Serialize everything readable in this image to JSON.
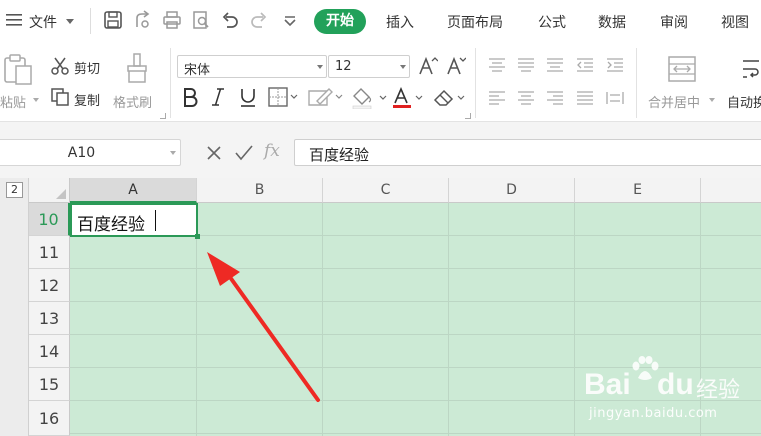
{
  "menubar": {
    "file_label": "文件",
    "tabs": [
      "开始",
      "插入",
      "页面布局",
      "公式",
      "数据",
      "审阅",
      "视图"
    ],
    "active_tab": "开始"
  },
  "ribbon": {
    "paste_label": "粘贴",
    "cut_label": "剪切",
    "copy_label": "复制",
    "format_painter_label": "格式刷",
    "font_name": "宋体",
    "font_size": "12",
    "merge_center_label": "合并居中",
    "auto_wrap_label": "自动换"
  },
  "formula_bar": {
    "name_box": "A10",
    "fx_label": "fx",
    "formula_value": "百度经验"
  },
  "sheet": {
    "outline_level": "2",
    "columns": [
      "A",
      "B",
      "C",
      "D",
      "E"
    ],
    "rows": [
      "10",
      "11",
      "12",
      "13",
      "14",
      "15",
      "16"
    ],
    "active_cell_value": "百度经验"
  },
  "watermark": {
    "brand_left": "Bai",
    "brand_right": "du",
    "brand_cn": "经验",
    "url": "jingyan.baidu.com"
  },
  "colors": {
    "accent_green": "#22a15a",
    "sheet_bg": "#ccead5",
    "arrow_red": "#ee2a24"
  }
}
